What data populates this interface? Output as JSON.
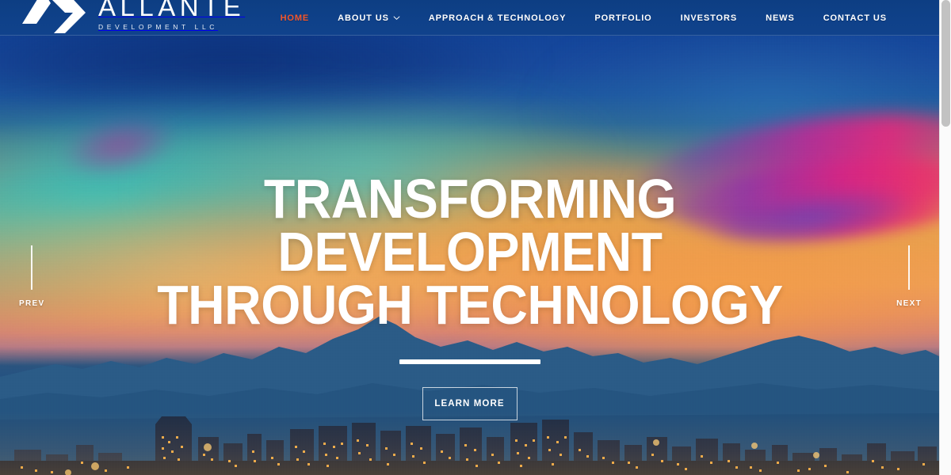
{
  "site": {
    "brand": {
      "name": "ALLANTE",
      "tagline": "DEVELOPMENT LLC",
      "logo_icon": "allante-chevron-arrow-logo"
    },
    "accent_color": "#f4562a",
    "header_color": "#0f4189"
  },
  "nav": {
    "items": [
      {
        "label": "HOME",
        "active": true,
        "has_dropdown": false
      },
      {
        "label": "ABOUT US",
        "active": false,
        "has_dropdown": true
      },
      {
        "label": "APPROACH & TECHNOLOGY",
        "active": false,
        "has_dropdown": false
      },
      {
        "label": "PORTFOLIO",
        "active": false,
        "has_dropdown": false
      },
      {
        "label": "INVESTORS",
        "active": false,
        "has_dropdown": false
      },
      {
        "label": "NEWS",
        "active": false,
        "has_dropdown": false
      },
      {
        "label": "CONTACT US",
        "active": false,
        "has_dropdown": false
      }
    ]
  },
  "hero": {
    "headline_line1": "TRANSFORMING DEVELOPMENT",
    "headline_line2": "THROUGH TECHNOLOGY",
    "cta_label": "LEARN MORE",
    "background_description": "Phoenix desert sunset skyline with mountain silhouette"
  },
  "slider": {
    "prev_label": "PREV",
    "next_label": "NEXT"
  },
  "scrollbar": {
    "thumb_position": "top",
    "track_color": "#fbfbfb",
    "thumb_color": "#c2c2c2"
  }
}
